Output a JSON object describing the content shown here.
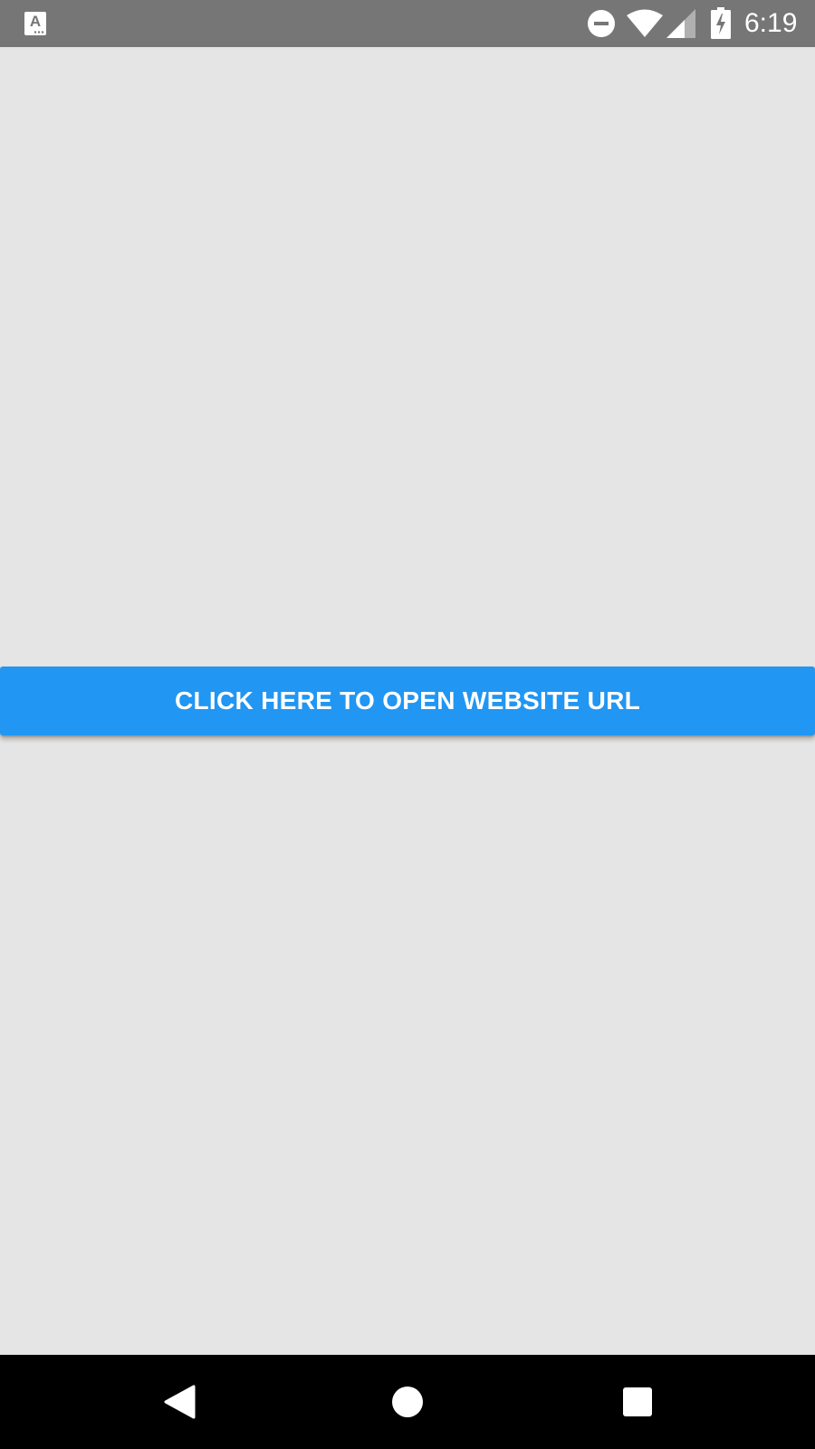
{
  "status_bar": {
    "time": "6:19",
    "notification_icon": "accessibility-app-icon",
    "icons": [
      "do-not-disturb-icon",
      "wifi-icon",
      "signal-icon",
      "battery-charging-icon"
    ]
  },
  "main": {
    "button_label": "CLICK HERE TO OPEN WEBSITE URL"
  },
  "nav_bar": {
    "icons": [
      "back-icon",
      "home-icon",
      "recents-icon"
    ]
  },
  "colors": {
    "status_bar": "#767676",
    "background": "#e5e5e5",
    "button": "#2196f3",
    "button_text": "#ffffff",
    "nav_bar": "#000000"
  }
}
